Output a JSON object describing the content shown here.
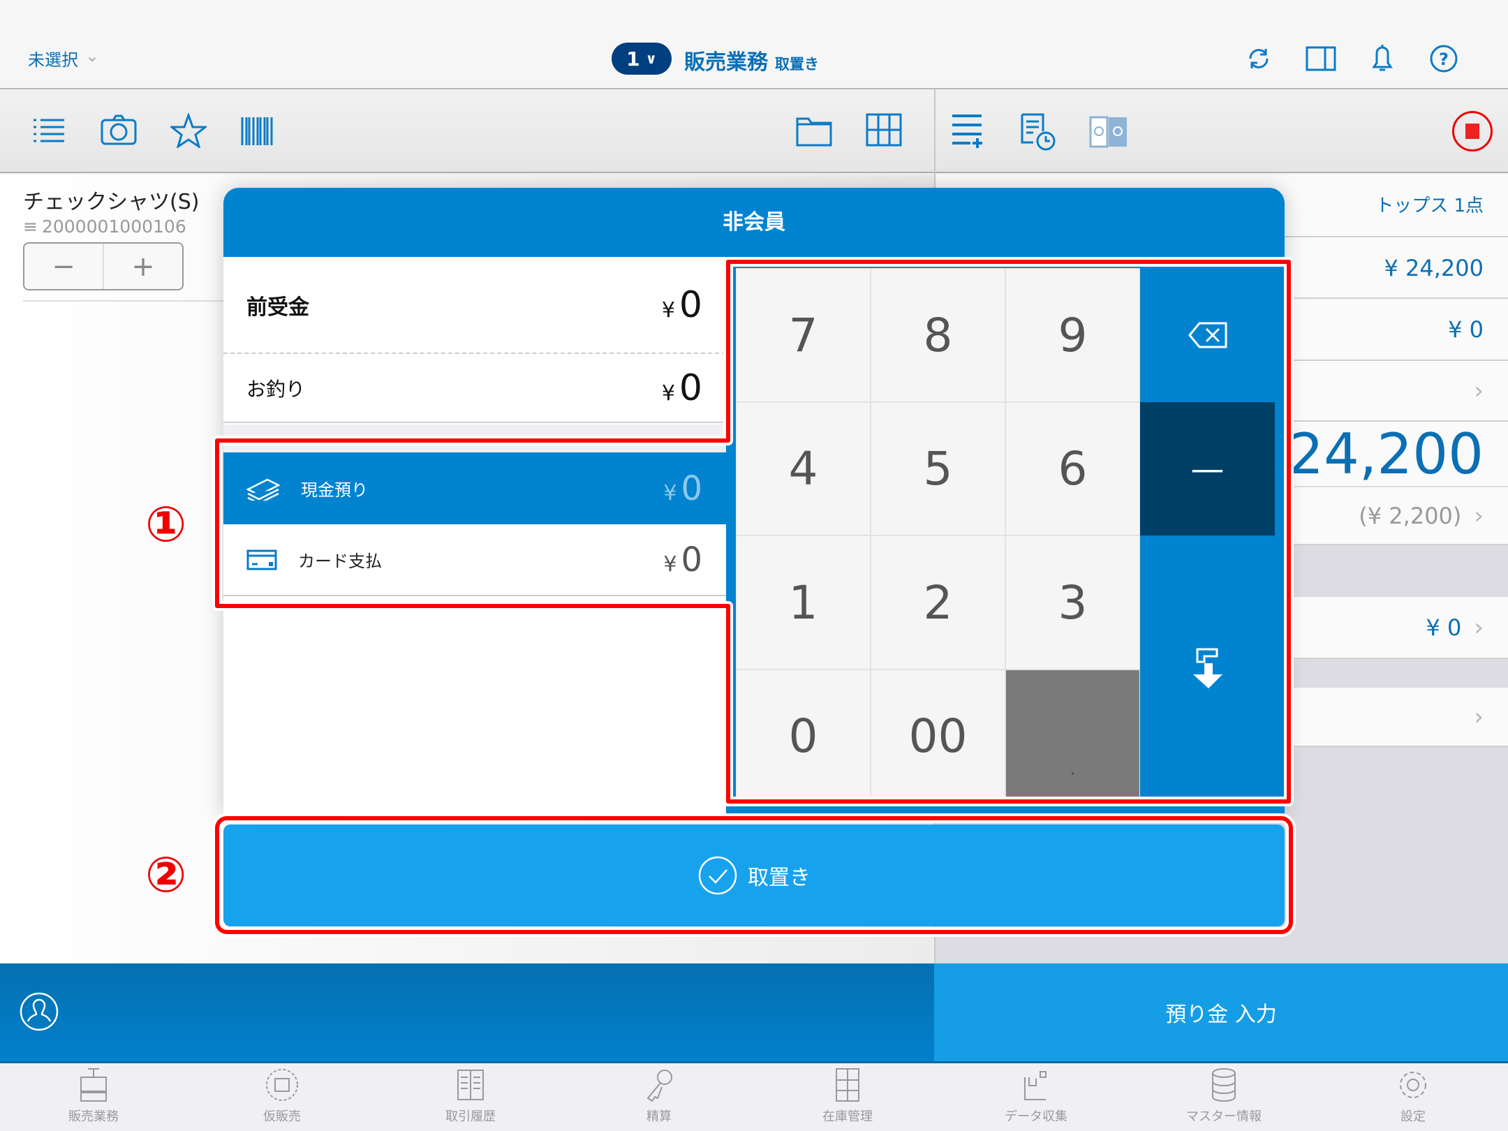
{
  "header": {
    "store_select": "未選択",
    "register_number": "1",
    "title": "販売業務",
    "mode": "取置き"
  },
  "product": {
    "name": "チェックシャツ(S)",
    "code": "2000001000106",
    "minus": "−",
    "plus": "+"
  },
  "summary": {
    "category_count": "トップス 1点",
    "subtotal": "¥ 24,200",
    "discount": "¥ 0",
    "total_yen": "¥",
    "total": "24,200",
    "tax": "(¥ 2,200)",
    "points": "¥ 0"
  },
  "modal": {
    "title": "非会員",
    "deposit_label": "前受金",
    "deposit_yen": "¥",
    "deposit_value": "0",
    "change_label": "お釣り",
    "change_yen": "¥",
    "change_value": "0",
    "payments": [
      {
        "label": "現金預り",
        "yen": "¥",
        "value": "0",
        "selected": true,
        "icon": "cash-icon"
      },
      {
        "label": "カード支払",
        "yen": "¥",
        "value": "0",
        "selected": false,
        "icon": "card-icon"
      }
    ],
    "keys": [
      "7",
      "8",
      "9",
      "4",
      "5",
      "6",
      "1",
      "2",
      "3",
      "0",
      "00",
      "."
    ],
    "minus_key": "—",
    "confirm_label": "取置き"
  },
  "annotations": {
    "one": "①",
    "two": "②"
  },
  "bottom": {
    "deposit_input": "預り金 入力"
  },
  "tabs": [
    "販売業務",
    "仮販売",
    "取引履歴",
    "精算",
    "在庫管理",
    "データ収集",
    "マスター情報",
    "設定"
  ],
  "colors": {
    "primary": "#0283d0",
    "accent": "#17a2ee",
    "dark_key": "#003f66",
    "annotation": "#ff0000"
  }
}
